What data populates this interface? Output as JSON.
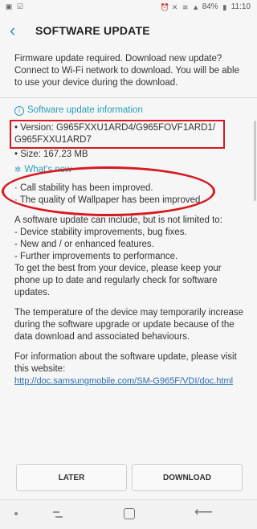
{
  "status_bar": {
    "left_icons": [
      "gallery-icon",
      "check-icon"
    ],
    "battery_percent": "84%",
    "time": "11:10"
  },
  "app_bar": {
    "title": "SOFTWARE UPDATE"
  },
  "intro_text": "Firmware update required. Download new update? Connect to Wi-Fi network to download. You will be able to use your device during the download.",
  "info_section": {
    "heading": "Software update information",
    "version_label": "• Version: G965FXXU1ARD4/G965FOVF1ARD1/",
    "version_line2": "G965FXXU1ARD7",
    "size_label": "• Size: 167.23 MB"
  },
  "whats_new": {
    "heading": "What's new",
    "items": [
      "· Call stability has been improved.",
      "· The quality of Wallpaper has been improved."
    ]
  },
  "details": {
    "intro": "A software update can include, but is not limited to:",
    "items": [
      "- Device stability improvements, bug fixes.",
      "- New and / or enhanced features.",
      "- Further improvements to performance."
    ],
    "advice": "To get the best from your device, please keep your phone up to date and regularly check for software updates.",
    "temperature_note": "The temperature of the device may temporarily increase during the software upgrade or update because of the data download and associated behaviours.",
    "more_info": "For information about the software update, please visit this website:",
    "link": "http://doc.samsungmobile.com/SM-G965F/VDI/doc.html"
  },
  "buttons": {
    "later": "LATER",
    "download": "DOWNLOAD"
  },
  "colors": {
    "accent": "#2a9fb5",
    "annotation_red": "#d71920",
    "background": "#f6f6f6"
  }
}
